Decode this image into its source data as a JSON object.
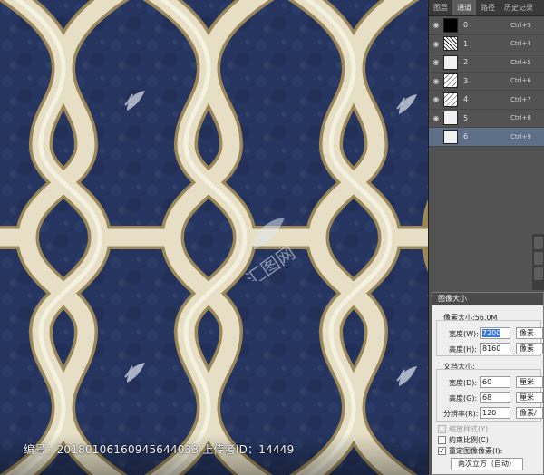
{
  "footer": {
    "text": "编号：20180106160945644033 上传者ID：14449"
  },
  "watermark": {
    "center_text": "汇图网"
  },
  "panel": {
    "tabs": [
      {
        "label": "图层"
      },
      {
        "label": "通道"
      },
      {
        "label": "路径"
      },
      {
        "label": "历史记录"
      }
    ],
    "active_tab": "通道",
    "channels": [
      {
        "name": "0",
        "shortcut": "Ctrl+3",
        "thumb": "black"
      },
      {
        "name": "1",
        "shortcut": "Ctrl+4",
        "thumb": "noise"
      },
      {
        "name": "2",
        "shortcut": "Ctrl+5",
        "thumb": "light"
      },
      {
        "name": "3",
        "shortcut": "Ctrl+6",
        "thumb": "lines"
      },
      {
        "name": "4",
        "shortcut": "Ctrl+7",
        "thumb": "lines"
      },
      {
        "name": "5",
        "shortcut": "Ctrl+8",
        "thumb": "light"
      },
      {
        "name": "6",
        "shortcut": "Ctrl+9",
        "thumb": "light"
      }
    ]
  },
  "dialog": {
    "title": "图像大小",
    "pixel_dims_label": "像素大小:56.0M",
    "width_label": "宽度(W):",
    "width_value": "7200",
    "width_unit": "像素",
    "height_label": "高度(H):",
    "height_value": "8160",
    "height_unit": "像素",
    "doc_size_label": "文档大小:",
    "doc_width_label": "宽度(D):",
    "doc_width_value": "60",
    "doc_width_unit": "厘米",
    "doc_height_label": "高度(G):",
    "doc_height_value": "68",
    "doc_height_unit": "厘米",
    "resolution_label": "分辨率(R):",
    "resolution_value": "120",
    "resolution_unit": "像素/",
    "scale_styles_label": "缩放样式(Y)",
    "constrain_label": "约束比例(C)",
    "resample_label": "重定图像像素(I):",
    "resample_method": "两次立方（自动）"
  },
  "colors": {
    "background_navy": "#25355f",
    "trellis_cream": "#e8e1c8",
    "trellis_outline": "#a8956a",
    "selected_channel": "#5e6f88"
  }
}
